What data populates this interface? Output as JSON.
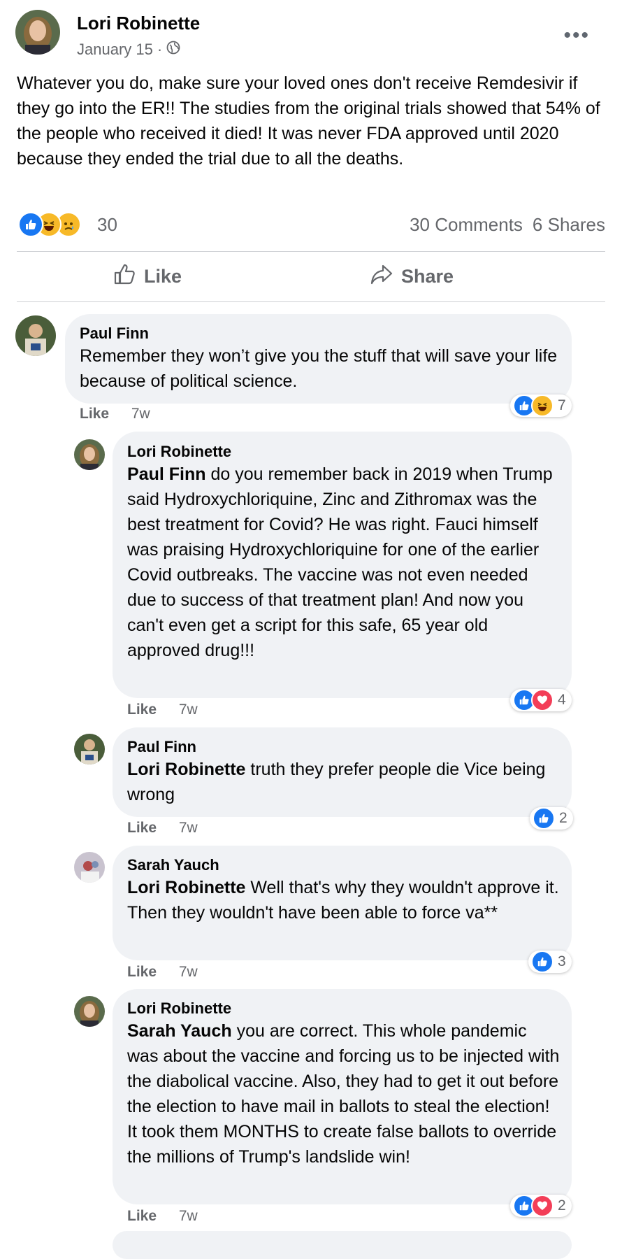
{
  "post": {
    "author": "Lori Robinette",
    "date": "January 15",
    "date_separator": "·",
    "more_label": "•••",
    "text": "Whatever you do, make sure your loved ones don't receive Remdesivir if they go into the ER!!  The studies from the original trials showed that 54% of the people who received it died!  It was never FDA approved until 2020 because they ended the trial due to all the deaths.",
    "reactions": [
      "like-icon",
      "haha-icon",
      "sad-icon"
    ],
    "reaction_count": "30",
    "comments_count": "30 Comments",
    "shares_count": "6 Shares"
  },
  "actions": {
    "like": "Like",
    "share": "Share"
  },
  "comments": [
    {
      "author": "Paul Finn",
      "mention": "",
      "text": "Remember they won’t give you the stuff that will save your life because of political science.",
      "like": "Like",
      "time": "7w",
      "reactions": [
        "like-icon",
        "haha-icon"
      ],
      "count": "7"
    },
    {
      "author": "Lori Robinette",
      "mention": "Paul Finn",
      "text": "do you remember back in 2019 when Trump said Hydroxychloriquine, Zinc and Zithromax was the best treatment for Covid? He was right. Fauci himself was praising Hydroxychloriquine for one of the earlier Covid outbreaks. The vaccine was not even needed due to success of that treatment plan! And now you can't even get a script for this safe, 65 year old approved drug!!!",
      "like": "Like",
      "time": "7w",
      "reactions": [
        "like-icon",
        "love-icon"
      ],
      "count": "4"
    },
    {
      "author": "Paul Finn",
      "mention": "Lori Robinette",
      "text": "truth they prefer people die Vice being wrong",
      "like": "Like",
      "time": "7w",
      "reactions": [
        "like-icon"
      ],
      "count": "2"
    },
    {
      "author": "Sarah Yauch",
      "mention": "Lori Robinette",
      "text": "Well that's why they wouldn't approve it. Then they wouldn't have been able to force va**",
      "like": "Like",
      "time": "7w",
      "reactions": [
        "like-icon"
      ],
      "count": "3"
    },
    {
      "author": "Lori Robinette",
      "mention": "Sarah Yauch",
      "text": "you are correct. This whole pandemic was about the vaccine and forcing us to be injected with the diabolical vaccine. Also, they had to get it out before the election to have mail in ballots to steal the election! It took them MONTHS to create false ballots to override the millions of Trump's landslide win!",
      "like": "Like",
      "time": "7w",
      "reactions": [
        "like-icon",
        "love-icon"
      ],
      "count": "2"
    }
  ],
  "colors": {
    "like_blue": "#1877f2",
    "love_red": "#f33e58",
    "emoji_yellow": "#f7b928",
    "bubble_gray": "#f0f2f5",
    "meta_gray": "#65676b"
  }
}
